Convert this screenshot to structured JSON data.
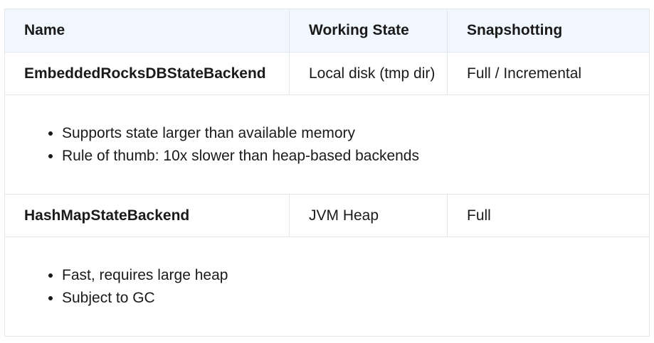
{
  "table": {
    "headers": [
      "Name",
      "Working State",
      "Snapshotting"
    ],
    "rows": [
      {
        "name": "EmbeddedRocksDBStateBackend",
        "working_state": "Local disk (tmp dir)",
        "snapshotting": "Full / Incremental",
        "notes": [
          "Supports state larger than available memory",
          "Rule of thumb: 10x slower than heap-based backends"
        ]
      },
      {
        "name": "HashMapStateBackend",
        "working_state": "JVM Heap",
        "snapshotting": "Full",
        "notes": [
          "Fast, requires large heap",
          "Subject to GC"
        ]
      }
    ]
  }
}
